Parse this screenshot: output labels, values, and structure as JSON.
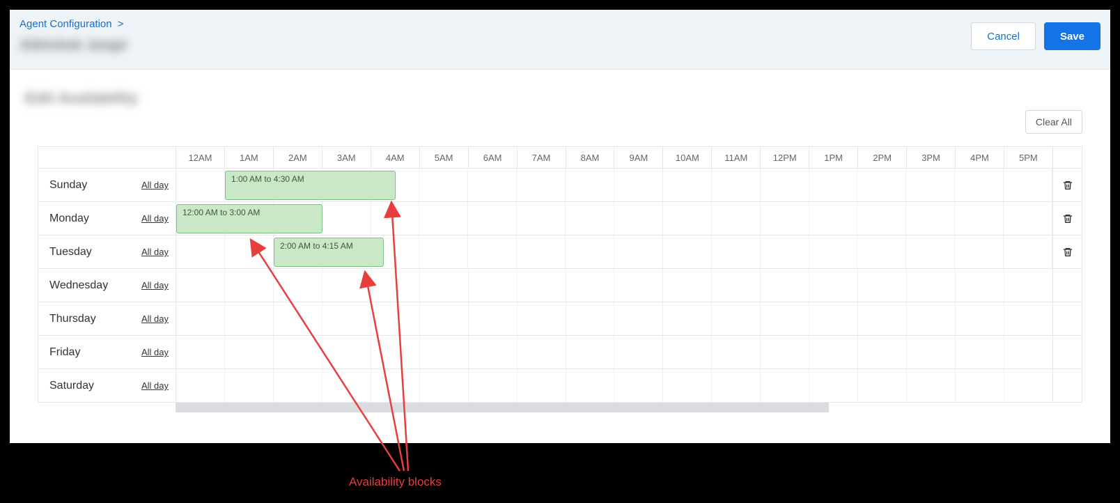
{
  "breadcrumb": {
    "label": "Agent Configuration",
    "chevron": ">"
  },
  "subheading_blur": "Abhishek Jangir",
  "section_title_blur": "Edit Availability",
  "buttons": {
    "cancel": "Cancel",
    "save": "Save",
    "clear_all": "Clear All"
  },
  "hours": [
    "12AM",
    "1AM",
    "2AM",
    "3AM",
    "4AM",
    "5AM",
    "6AM",
    "7AM",
    "8AM",
    "9AM",
    "10AM",
    "11AM",
    "12PM",
    "1PM",
    "2PM",
    "3PM",
    "4PM",
    "5PM"
  ],
  "all_day_label": "All day",
  "days": [
    {
      "name": "Sunday",
      "has_delete": true,
      "blocks": [
        {
          "label": "1:00 AM to 4:30 AM",
          "start_h": 1.0,
          "end_h": 4.5
        }
      ]
    },
    {
      "name": "Monday",
      "has_delete": true,
      "blocks": [
        {
          "label": "12:00 AM to 3:00 AM",
          "start_h": 0.0,
          "end_h": 3.0
        }
      ]
    },
    {
      "name": "Tuesday",
      "has_delete": true,
      "blocks": [
        {
          "label": "2:00 AM to 4:15 AM",
          "start_h": 2.0,
          "end_h": 4.25
        }
      ]
    },
    {
      "name": "Wednesday",
      "has_delete": false,
      "blocks": []
    },
    {
      "name": "Thursday",
      "has_delete": false,
      "blocks": []
    },
    {
      "name": "Friday",
      "has_delete": false,
      "blocks": []
    },
    {
      "name": "Saturday",
      "has_delete": false,
      "blocks": []
    }
  ],
  "annotation": {
    "label": "Availability blocks"
  }
}
